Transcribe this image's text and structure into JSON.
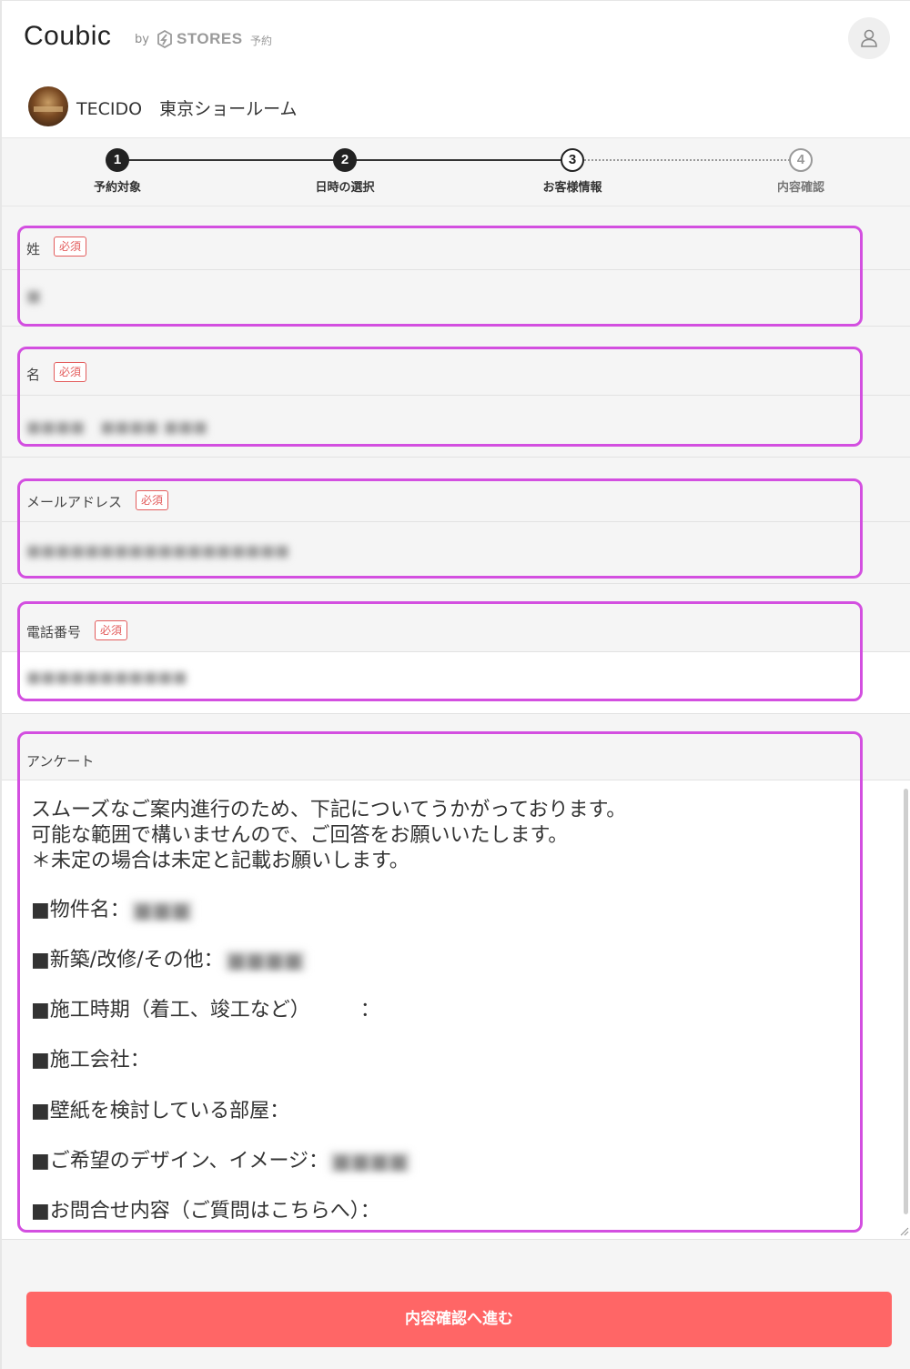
{
  "header": {
    "logo": "Coubic",
    "by": "by",
    "stores": "STORES",
    "stores_sub": "予約",
    "user_icon": "user-icon"
  },
  "shop": {
    "name": "TECIDO　東京ショールーム"
  },
  "stepper": {
    "steps": [
      {
        "num": "1",
        "label": "予約対象",
        "state": "done"
      },
      {
        "num": "2",
        "label": "日時の選択",
        "state": "done"
      },
      {
        "num": "3",
        "label": "お客様情報",
        "state": "current"
      },
      {
        "num": "4",
        "label": "内容確認",
        "state": "todo"
      }
    ]
  },
  "form": {
    "required_badge": "必須",
    "last_name": {
      "label": "姓",
      "value": "■"
    },
    "first_name": {
      "label": "名",
      "value": "■■■■　■■■■ ■■■"
    },
    "email": {
      "label": "メールアドレス",
      "value": "■■■■■■■■■■■■■■■■■■"
    },
    "phone": {
      "label": "電話番号",
      "value": "■■■■■■■■■■■"
    },
    "survey": {
      "label": "アンケート",
      "intro": [
        "スムーズなご案内進行のため、下記についてうかがっております。",
        "可能な範囲で構いませんので、ご回答をお願いいたします。",
        "＊未定の場合は未定と記載お願いします。"
      ],
      "q_property": "■物件名：",
      "a_property": "■■■",
      "q_type": "■新築/改修/その他：",
      "a_type": "■■■■",
      "q_period": "■施工時期（着工、竣工など）　　　：",
      "q_company": "■施工会社：",
      "q_room": "■壁紙を検討している部屋：",
      "q_design": "■ご希望のデザイン、イメージ：",
      "a_design": "■■■■",
      "q_inquiry": "■お問合せ内容（ご質問はこちらへ）："
    }
  },
  "submit": {
    "label": "内容確認へ進む"
  },
  "colors": {
    "accent": "#ff6666",
    "highlight": "#d34fe0",
    "required": "#e35c5c"
  }
}
